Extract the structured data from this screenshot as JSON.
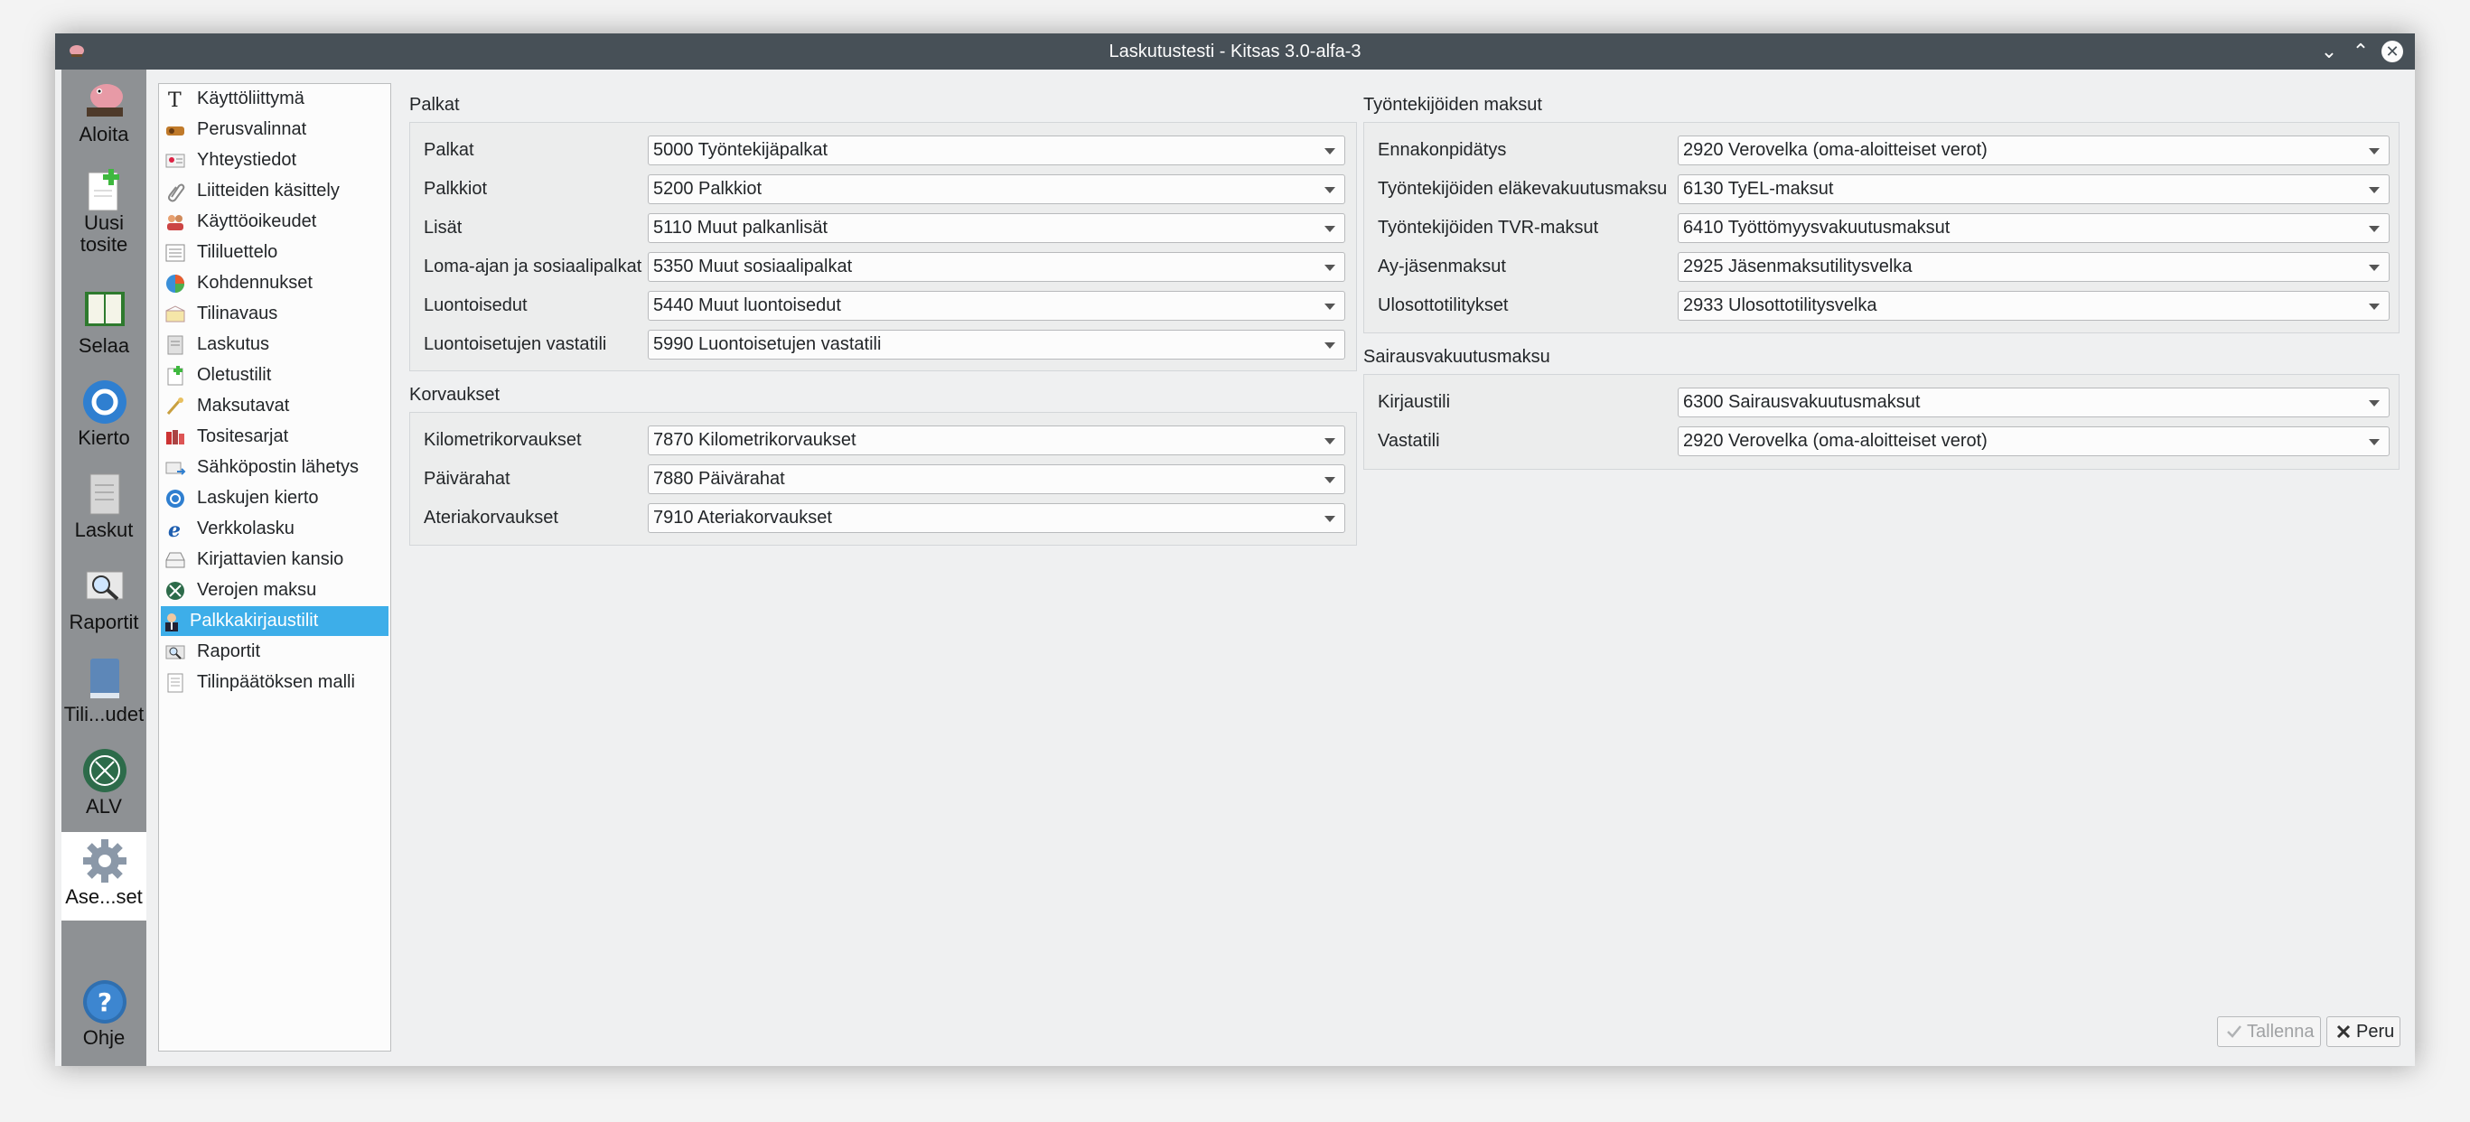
{
  "window": {
    "title": "Laskutustesti - Kitsas 3.0-alfa-3"
  },
  "toolbar": {
    "items": [
      {
        "label": "Aloita",
        "icon": "piggy-bank-icon"
      },
      {
        "label": "Uusi\ntosite",
        "icon": "new-document-icon"
      },
      {
        "label": "Selaa",
        "icon": "book-icon"
      },
      {
        "label": "Kierto",
        "icon": "cycle-icon"
      },
      {
        "label": "Laskut",
        "icon": "invoice-icon"
      },
      {
        "label": "Raportit",
        "icon": "report-icon"
      },
      {
        "label": "Tili...udet",
        "icon": "ledger-icon"
      },
      {
        "label": "ALV",
        "icon": "vat-icon"
      },
      {
        "label": "Ase...set",
        "icon": "gear-icon"
      },
      {
        "label": "Ohje",
        "icon": "help-icon"
      }
    ]
  },
  "settings_list": {
    "items": [
      {
        "label": "Käyttöliittymä",
        "icon": "text-icon"
      },
      {
        "label": "Perusvalinnat",
        "icon": "basic-settings-icon"
      },
      {
        "label": "Yhteystiedot",
        "icon": "contact-card-icon"
      },
      {
        "label": "Liitteiden käsittely",
        "icon": "paperclip-icon"
      },
      {
        "label": "Käyttöoikeudet",
        "icon": "users-icon"
      },
      {
        "label": "Tililuettelo",
        "icon": "account-list-icon"
      },
      {
        "label": "Kohdennukset",
        "icon": "pie-chart-icon"
      },
      {
        "label": "Tilinavaus",
        "icon": "opening-icon"
      },
      {
        "label": "Laskutus",
        "icon": "invoicing-icon"
      },
      {
        "label": "Oletustilit",
        "icon": "default-accounts-icon"
      },
      {
        "label": "Maksutavat",
        "icon": "payment-icon"
      },
      {
        "label": "Tositesarjat",
        "icon": "voucher-series-icon"
      },
      {
        "label": "Sähköpostin lähetys",
        "icon": "email-send-icon"
      },
      {
        "label": "Laskujen kierto",
        "icon": "circulation-icon"
      },
      {
        "label": "Verkkolasku",
        "icon": "e-invoice-icon"
      },
      {
        "label": "Kirjattavien kansio",
        "icon": "inbox-icon"
      },
      {
        "label": "Verojen maksu",
        "icon": "tax-icon"
      },
      {
        "label": "Palkkakirjaustilit",
        "icon": "payroll-icon"
      },
      {
        "label": "Raportit",
        "icon": "report-icon"
      },
      {
        "label": "Tilinpäätöksen malli",
        "icon": "template-icon"
      }
    ],
    "selected": "Palkkakirjaustilit"
  },
  "palkat": {
    "title": "Palkat",
    "rows": [
      {
        "label": "Palkat",
        "value": "5000 Työntekijäpalkat"
      },
      {
        "label": "Palkkiot",
        "value": "5200 Palkkiot"
      },
      {
        "label": "Lisät",
        "value": "5110 Muut palkanlisät"
      },
      {
        "label": "Loma-ajan ja sosiaalipalkat",
        "value": "5350 Muut sosiaalipalkat"
      },
      {
        "label": "Luontoisedut",
        "value": "5440 Muut luontoisedut"
      },
      {
        "label": "Luontoisetujen vastatili",
        "value": "5990 Luontoisetujen vastatili"
      }
    ]
  },
  "korvaukset": {
    "title": "Korvaukset",
    "rows": [
      {
        "label": "Kilometrikorvaukset",
        "value": "7870 Kilometrikorvaukset"
      },
      {
        "label": "Päivärahat",
        "value": "7880 Päivärahat"
      },
      {
        "label": "Ateriakorvaukset",
        "value": "7910 Ateriakorvaukset"
      }
    ]
  },
  "tyontekijoiden_maksut": {
    "title": "Työntekijöiden maksut",
    "rows": [
      {
        "label": "Ennakonpidätys",
        "value": "2920 Verovelka (oma-aloitteiset verot)"
      },
      {
        "label": "Työntekijöiden eläkevakuutusmaksu",
        "value": "6130 TyEL-maksut"
      },
      {
        "label": "Työntekijöiden TVR-maksut",
        "value": "6410 Työttömyysvakuutusmaksut"
      },
      {
        "label": "Ay-jäsenmaksut",
        "value": "2925 Jäsenmaksutilitysvelka"
      },
      {
        "label": "Ulosottotilitykset",
        "value": "2933 Ulosottotilitysvelka"
      }
    ]
  },
  "sairausvakuutusmaksu": {
    "title": "Sairausvakuutusmaksu",
    "rows": [
      {
        "label": "Kirjaustili",
        "value": "6300 Sairausvakuutusmaksut"
      },
      {
        "label": "Vastatili",
        "value": "2920 Verovelka (oma-aloitteiset verot)"
      }
    ]
  },
  "buttons": {
    "save": "Tallenna",
    "cancel": "Peru"
  },
  "colors": {
    "titlebar": "#475057",
    "selection": "#3daee9",
    "toolbar": "#8e9194"
  }
}
